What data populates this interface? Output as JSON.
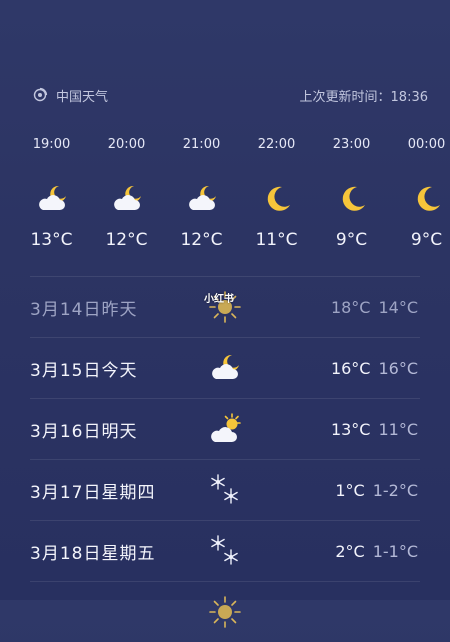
{
  "header": {
    "app_name": "中国天气",
    "last_update": "上次更新时间：18:36"
  },
  "hourly": [
    {
      "time": "19:00",
      "icon": "cloud-moon-icon",
      "temp": "13°C"
    },
    {
      "time": "20:00",
      "icon": "cloud-moon-icon",
      "temp": "12°C"
    },
    {
      "time": "21:00",
      "icon": "cloud-moon-icon",
      "temp": "12°C"
    },
    {
      "time": "22:00",
      "icon": "moon-icon",
      "temp": "11°C"
    },
    {
      "time": "23:00",
      "icon": "moon-icon",
      "temp": "9°C"
    },
    {
      "time": "00:00",
      "icon": "moon-icon",
      "temp": "9°C"
    }
  ],
  "daily": [
    {
      "label": "3月14日昨天",
      "icon": "sun-icon",
      "high": "18°C",
      "low": "14°C",
      "past": true
    },
    {
      "label": "3月15日今天",
      "icon": "cloud-moon-icon",
      "high": "16°C",
      "low": "16°C",
      "past": false
    },
    {
      "label": "3月16日明天",
      "icon": "cloud-sun-icon",
      "high": "13°C",
      "low": "11°C",
      "past": false
    },
    {
      "label": "3月17日星期四",
      "icon": "snowflake-icon",
      "high": "1°C",
      "low": "1-2°C",
      "past": false
    },
    {
      "label": "3月18日星期五",
      "icon": "snowflake-icon",
      "high": "2°C",
      "low": "1-1°C",
      "past": false
    }
  ],
  "watermark": "小红书",
  "colors": {
    "background": "#2c3463",
    "moon": "#f6c53a",
    "cloud": "#f4f5fb"
  }
}
